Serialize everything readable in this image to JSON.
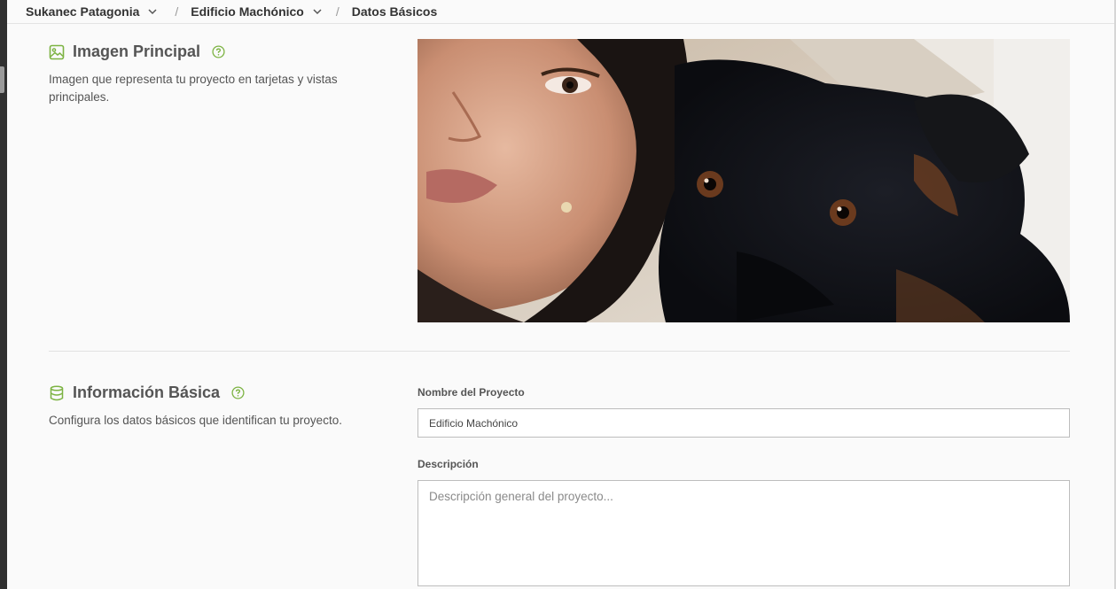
{
  "breadcrumb": {
    "items": [
      {
        "label": "Sukanec Patagonia",
        "has_dropdown": true
      },
      {
        "label": "Edificio Machónico",
        "has_dropdown": true
      },
      {
        "label": "Datos Básicos",
        "has_dropdown": false
      }
    ],
    "separator": "/"
  },
  "sections": {
    "image": {
      "title": "Imagen Principal",
      "icon": "image-icon",
      "help_icon": "help-circle-icon",
      "description": "Imagen que representa tu proyecto en tarjetas y vistas principales."
    },
    "basic_info": {
      "title": "Información Básica",
      "icon": "database-icon",
      "help_icon": "help-circle-icon",
      "description": "Configura los datos básicos que identifican tu proyecto.",
      "fields": {
        "name": {
          "label": "Nombre del Proyecto",
          "value": "Edificio Machónico"
        },
        "description": {
          "label": "Descripción",
          "value": "",
          "placeholder": "Descripción general del proyecto..."
        }
      }
    }
  },
  "colors": {
    "accent": "#7cb342",
    "border": "#bdbdbd",
    "text": "#444444"
  }
}
